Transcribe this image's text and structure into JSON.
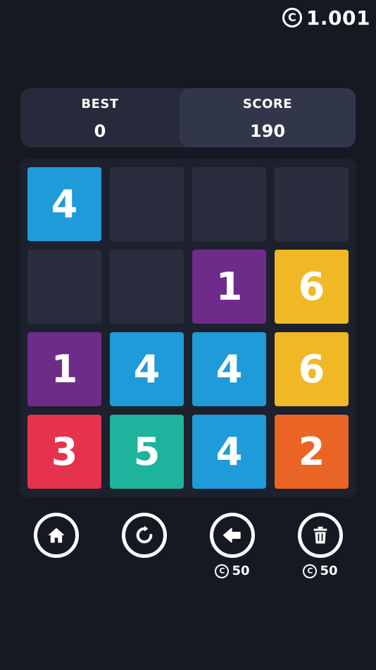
{
  "coins": {
    "icon": "coin-icon",
    "icon_glyph": "C",
    "value": "1.001"
  },
  "score_panel": {
    "best_label": "BEST",
    "best_value": "0",
    "score_label": "SCORE",
    "score_value": "190"
  },
  "colors": {
    "background": "#161922",
    "board": "#1d202d",
    "empty_cell": "#2a2d3d",
    "tile_1": "#6e2b8a",
    "tile_2": "#ea6525",
    "tile_3": "#e5334d",
    "tile_4": "#1e9bd8",
    "tile_5": "#1db39c",
    "tile_6": "#f0b824"
  },
  "board": {
    "rows": [
      [
        "4",
        "",
        "",
        ""
      ],
      [
        "",
        "",
        "1",
        "6"
      ],
      [
        "1",
        "4",
        "4",
        "6"
      ],
      [
        "3",
        "5",
        "4",
        "2"
      ]
    ]
  },
  "actions": [
    {
      "name": "home",
      "icon": "home-icon",
      "cost": ""
    },
    {
      "name": "restart",
      "icon": "restart-icon",
      "cost": ""
    },
    {
      "name": "undo",
      "icon": "undo-arrow-icon",
      "cost": "50"
    },
    {
      "name": "delete",
      "icon": "trash-icon",
      "cost": "50"
    }
  ],
  "cost_icon_glyph": "C"
}
